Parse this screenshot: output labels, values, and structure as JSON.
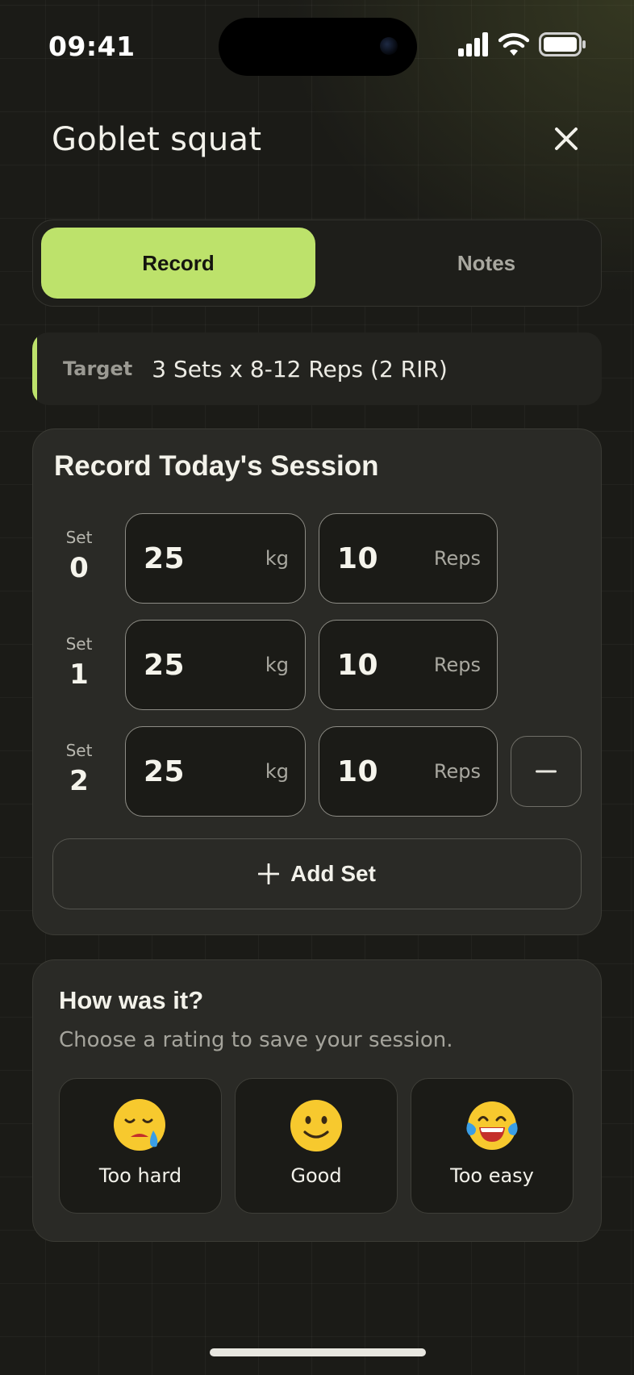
{
  "status_bar": {
    "time": "09:41"
  },
  "header": {
    "title": "Goblet squat"
  },
  "tabs": [
    {
      "label": "Record",
      "active": true
    },
    {
      "label": "Notes",
      "active": false
    }
  ],
  "target": {
    "label": "Target",
    "value": "3 Sets x 8-12 Reps (2 RIR)"
  },
  "record": {
    "title": "Record Today's Session",
    "set_word": "Set",
    "sets": [
      {
        "number": "0",
        "weight": "25",
        "weight_unit": "kg",
        "reps": "10",
        "reps_unit": "Reps"
      },
      {
        "number": "1",
        "weight": "25",
        "weight_unit": "kg",
        "reps": "10",
        "reps_unit": "Reps"
      },
      {
        "number": "2",
        "weight": "25",
        "weight_unit": "kg",
        "reps": "10",
        "reps_unit": "Reps"
      }
    ],
    "add_set_label": "Add Set"
  },
  "rating": {
    "title": "How was it?",
    "subtitle": "Choose a rating to save your session.",
    "options": [
      {
        "label": "Too hard",
        "icon": "sad-tear-face-icon"
      },
      {
        "label": "Good",
        "icon": "slightly-smiling-face-icon"
      },
      {
        "label": "Too easy",
        "icon": "tears-of-joy-face-icon"
      }
    ]
  },
  "colors": {
    "accent": "#bde26b",
    "background": "#1b1b17",
    "card": "#2a2a26",
    "emoji_yellow": "#f7c92e",
    "tear_blue": "#3a9ee6"
  }
}
